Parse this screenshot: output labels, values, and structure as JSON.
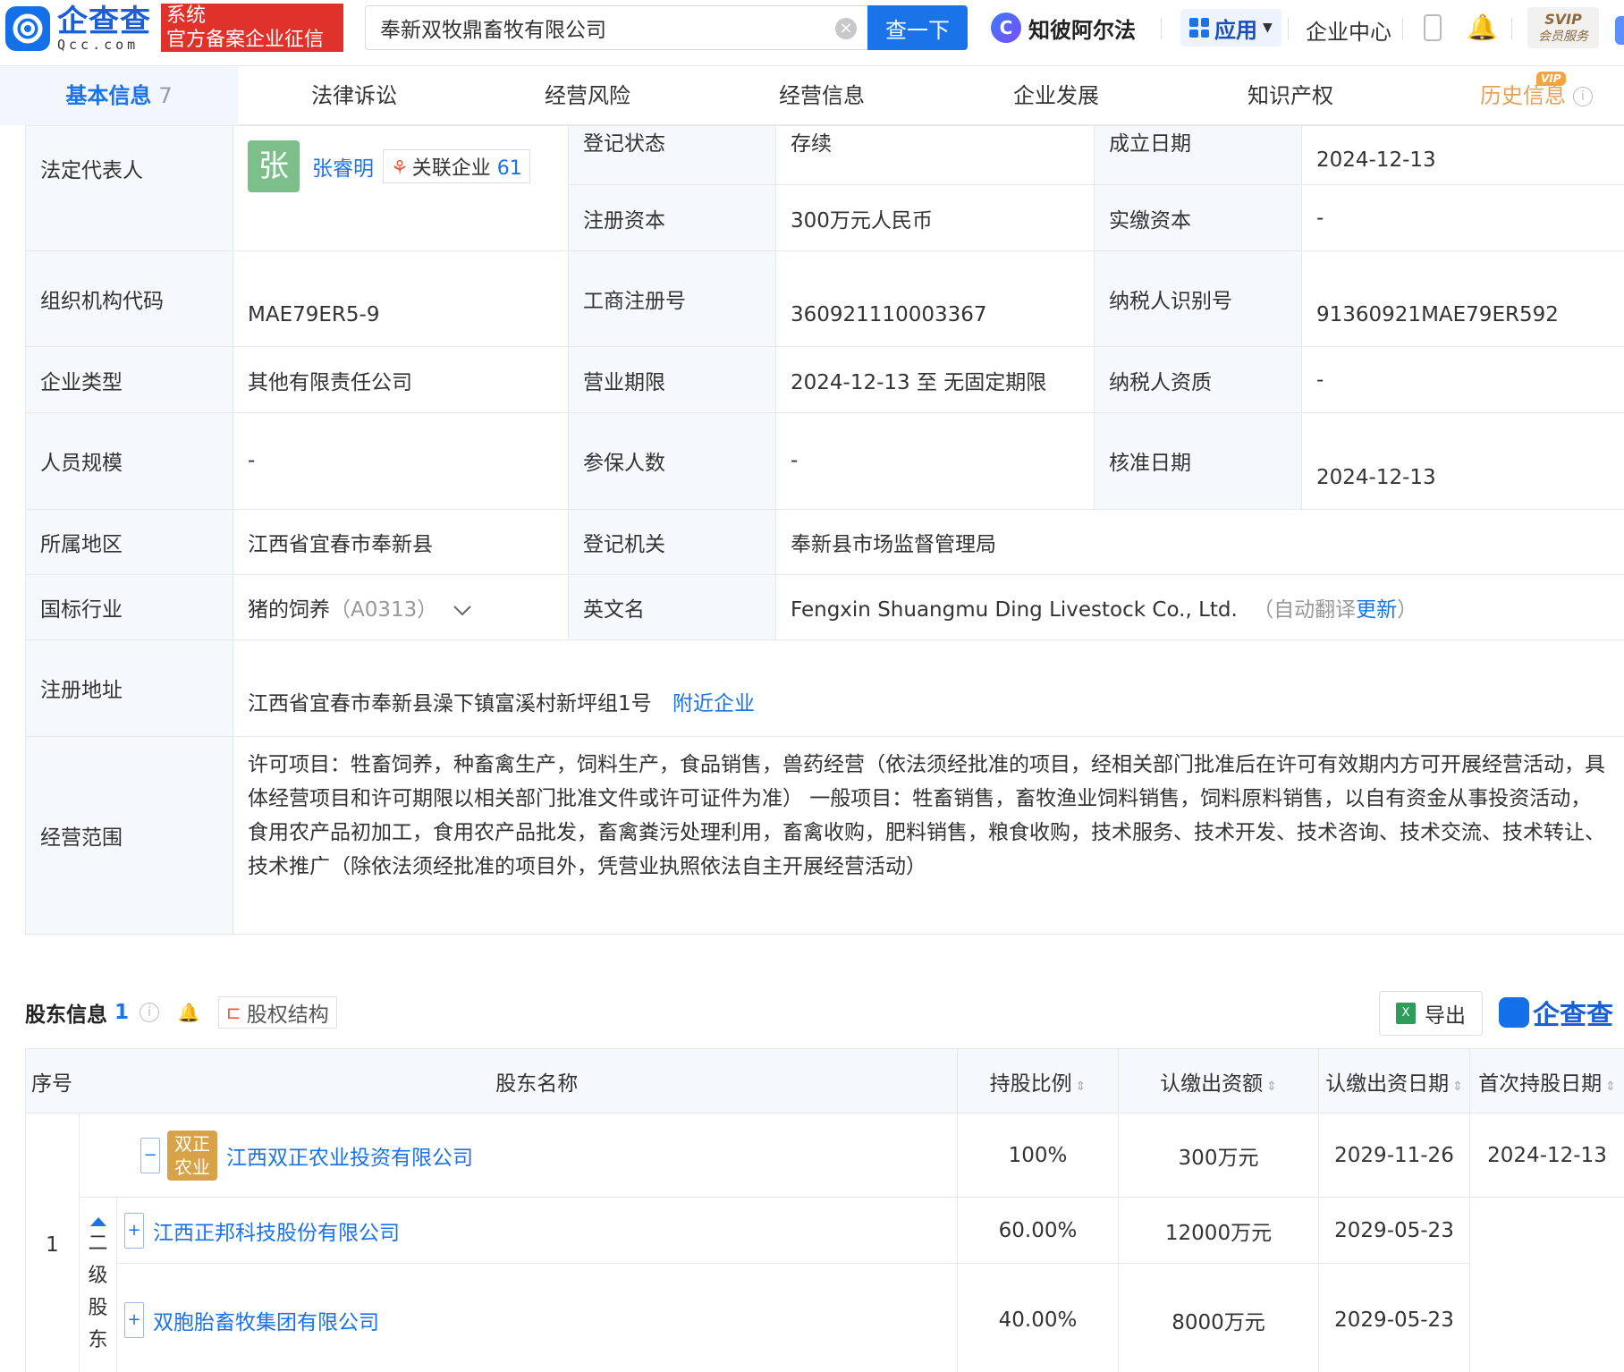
{
  "header": {
    "logo_cn": "企查查",
    "logo_en": "Qcc.com",
    "badge_line1": "系统",
    "badge_line2": "官方备案企业征信",
    "search_value": "奉新双牧鼎畜牧有限公司",
    "search_button": "查一下",
    "zhibi": "知彼阿尔法",
    "apps": "应用",
    "enterprise_center": "企业中心",
    "svip_top": "SVIP",
    "svip_bottom": "会员服务"
  },
  "tabs": [
    {
      "label": "基本信息",
      "count": "7"
    },
    {
      "label": "法律诉讼"
    },
    {
      "label": "经营风险"
    },
    {
      "label": "经营信息"
    },
    {
      "label": "企业发展"
    },
    {
      "label": "知识产权"
    },
    {
      "label": "历史信息",
      "badge": "VIP"
    }
  ],
  "basic_info": {
    "legal_rep_label": "法定代表人",
    "legal_rep_avatar": "张",
    "legal_rep_name": "张睿明",
    "related_label": "关联企业",
    "related_count": "61",
    "status_label": "登记状态",
    "status_value": "存续",
    "found_label": "成立日期",
    "found_value": "2024-12-13",
    "capital_label": "注册资本",
    "capital_value": "300万元人民币",
    "paid_label": "实缴资本",
    "paid_value": "-",
    "org_code_label": "组织机构代码",
    "org_code_value": "MAE79ER5-9",
    "reg_no_label": "工商注册号",
    "reg_no_value": "360921110003367",
    "tax_id_label": "纳税人识别号",
    "tax_id_value": "91360921MAE79ER592",
    "type_label": "企业类型",
    "type_value": "其他有限责任公司",
    "term_label": "营业期限",
    "term_value": "2024-12-13 至 无固定期限",
    "tax_qual_label": "纳税人资质",
    "tax_qual_value": "-",
    "staff_label": "人员规模",
    "staff_value": "-",
    "insured_label": "参保人数",
    "insured_value": "-",
    "approve_label": "核准日期",
    "approve_value": "2024-12-13",
    "region_label": "所属地区",
    "region_value": "江西省宜春市奉新县",
    "authority_label": "登记机关",
    "authority_value": "奉新县市场监督管理局",
    "industry_label": "国标行业",
    "industry_value": "猪的饲养",
    "industry_code": "（A0313）",
    "en_name_label": "英文名",
    "en_name_value": "Fengxin Shuangmu Ding Livestock Co., Ltd.",
    "en_name_note_prefix": "（自动翻译",
    "en_name_note_link": "更新",
    "en_name_note_suffix": "）",
    "address_label": "注册地址",
    "address_value": "江西省宜春市奉新县澡下镇富溪村新坪组1号",
    "address_link": "附近企业",
    "scope_label": "经营范围",
    "scope_value": "许可项目：牲畜饲养，种畜禽生产，饲料生产，食品销售，兽药经营（依法须经批准的项目，经相关部门批准后在许可有效期内方可开展经营活动，具体经营项目和许可期限以相关部门批准文件或许可证件为准） 一般项目：牲畜销售，畜牧渔业饲料销售，饲料原料销售，以自有资金从事投资活动，食用农产品初加工，食用农产品批发，畜禽粪污处理利用，畜禽收购，肥料销售，粮食收购，技术服务、技术开发、技术咨询、技术交流、技术转让、技术推广（除依法须经批准的项目外，凭营业执照依法自主开展经营活动）"
  },
  "shareholders": {
    "title": "股东信息",
    "count": "1",
    "structure_button": "股权结构",
    "export_button": "导出",
    "export_icon": "X",
    "brand": "企查查",
    "columns": [
      "序号",
      "股东名称",
      "持股比例",
      "认缴出资额",
      "认缴出资日期",
      "首次持股日期"
    ],
    "row_index": "1",
    "primary": {
      "logo": "双正农业",
      "name": "江西双正农业投资有限公司",
      "ratio": "100%",
      "amount": "300万元",
      "sub_date": "2029-11-26",
      "first_date": "2024-12-13"
    },
    "level_label": [
      "二",
      "级",
      "股",
      "东"
    ],
    "secondary": [
      {
        "name": "江西正邦科技股份有限公司",
        "ratio": "60.00%",
        "amount": "12000万元",
        "sub_date": "2029-05-23"
      },
      {
        "name": "双胞胎畜牧集团有限公司",
        "ratio": "40.00%",
        "amount": "8000万元",
        "sub_date": "2029-05-23"
      }
    ]
  }
}
